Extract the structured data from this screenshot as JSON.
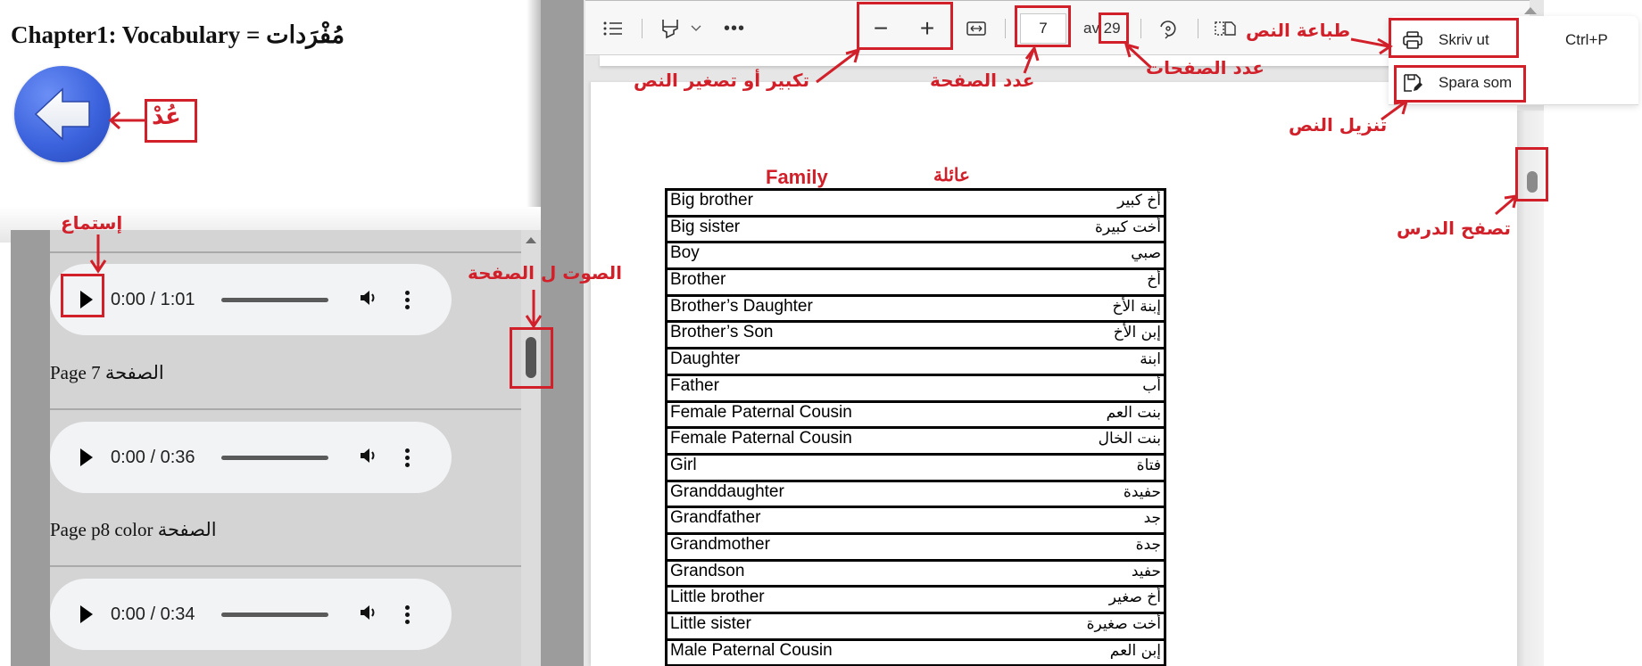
{
  "page": {
    "title": "Chapter1: Vocabulary = مُفْرَدات",
    "back_button_label": "Back"
  },
  "audio_panel": {
    "players": [
      {
        "time": "0:00 / 1:01",
        "label": "Page 7 الصفحة"
      },
      {
        "time": "0:00 / 0:36",
        "label": "Page p8 color الصفحة"
      },
      {
        "time": "0:00 / 0:34",
        "label": ""
      }
    ]
  },
  "pdf_viewer": {
    "toolbar": {
      "contents_icon": "list-icon",
      "draw_icon": "highlighter-icon",
      "more_icon": "ellipsis-icon",
      "zoom_out": "−",
      "zoom_in": "+",
      "fit_icon": "fit-width-icon",
      "current_page": "7",
      "page_of": "av 29",
      "rotate_icon": "rotate-icon",
      "page_view_icon": "page-view-icon"
    },
    "menu": {
      "items": [
        {
          "label": "Skriv ut",
          "shortcut": "Ctrl+P",
          "icon": "printer-icon"
        },
        {
          "label": "Spara som",
          "shortcut": "",
          "icon": "save-as-icon"
        }
      ]
    },
    "document": {
      "heading_en": "Family",
      "heading_ar": "عائلة",
      "rows": [
        {
          "en": "Big brother",
          "ar": "أخ  كبير"
        },
        {
          "en": "Big sister",
          "ar": "أخت كبيرة"
        },
        {
          "en": "Boy",
          "ar": "صبي"
        },
        {
          "en": "Brother",
          "ar": "أخ"
        },
        {
          "en": "Brother’s Daughter",
          "ar": "إبنة الأخ"
        },
        {
          "en": "Brother’s Son",
          "ar": "إبن الأخ"
        },
        {
          "en": "Daughter",
          "ar": "ابنة"
        },
        {
          "en": "Father",
          "ar": "أب"
        },
        {
          "en": "Female Paternal Cousin",
          "ar": "بنت العم"
        },
        {
          "en": "Female Paternal Cousin",
          "ar": "بنت الخال"
        },
        {
          "en": "Girl",
          "ar": "فتاة"
        },
        {
          "en": "Granddaughter",
          "ar": "حفيدة"
        },
        {
          "en": "Grandfather",
          "ar": "جد"
        },
        {
          "en": "Grandmother",
          "ar": "جدة"
        },
        {
          "en": "Grandson",
          "ar": "حفيد"
        },
        {
          "en": "Little brother",
          "ar": "أخ صغير"
        },
        {
          "en": "Little sister",
          "ar": "أخت صغيرة"
        },
        {
          "en": "Male Paternal Cousin",
          "ar": "إبن العم"
        }
      ]
    }
  },
  "annotations": {
    "back": "عُدْ",
    "listen": "إستماع",
    "page_audio": "الصوت ل الصفحة",
    "zoom": "تكبير أو تصغير النص",
    "page_number": "عدد الصفحة",
    "page_count": "عدد الصفحات",
    "print": "طباعة النص",
    "download": "تنزيل النص",
    "browse": "تصفح الدرس"
  },
  "colors": {
    "annotation_red": "#d1202a",
    "back_button_blue": "#3c63dd"
  }
}
